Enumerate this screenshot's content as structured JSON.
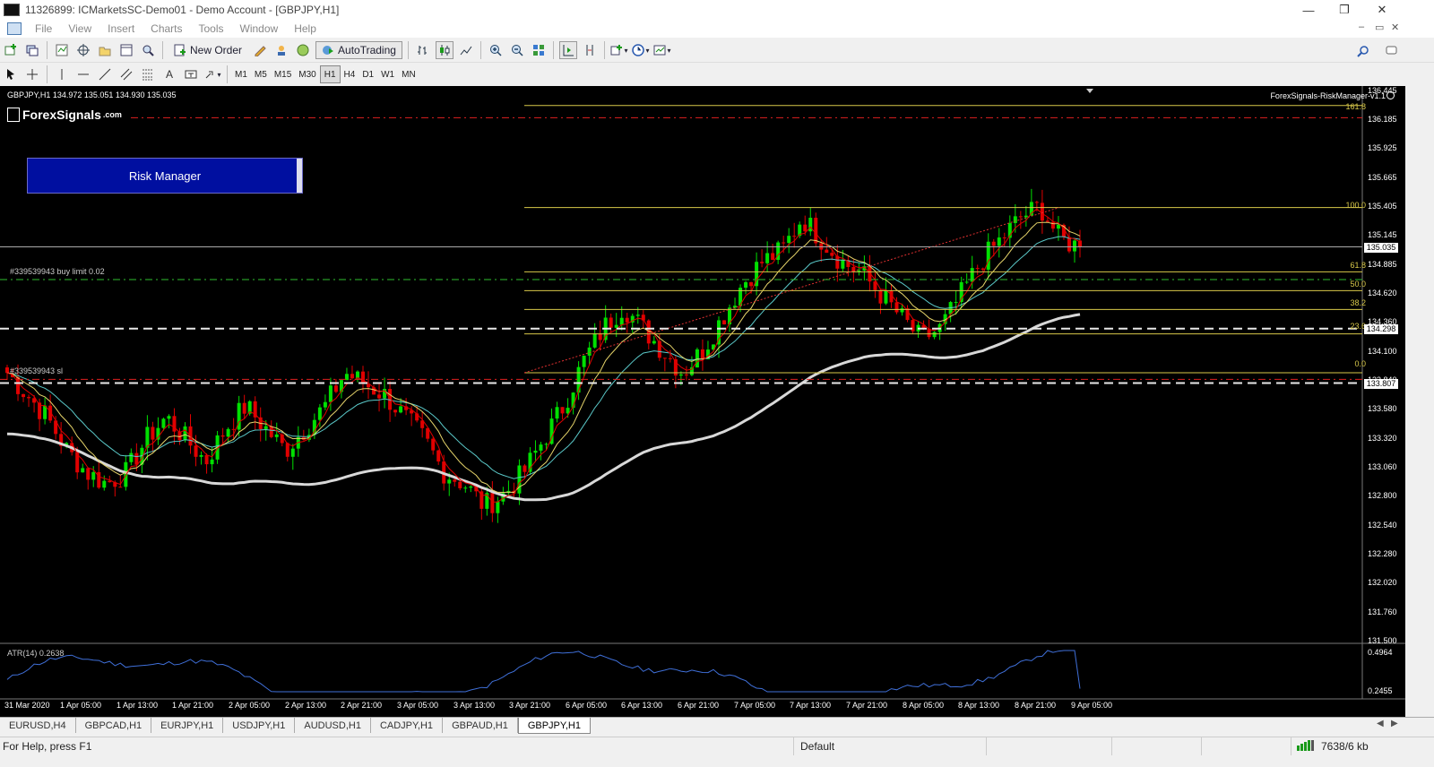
{
  "window": {
    "title": "11326899: ICMarketsSC-Demo01 - Demo Account - [GBPJPY,H1]",
    "controls": {
      "minimize": "—",
      "restore": "❐",
      "close": "✕"
    }
  },
  "menu": [
    "File",
    "View",
    "Insert",
    "Charts",
    "Tools",
    "Window",
    "Help"
  ],
  "toolbar": {
    "new_order": "New Order",
    "autotrading": "AutoTrading",
    "timeframes": [
      "M1",
      "M5",
      "M15",
      "M30",
      "H1",
      "H4",
      "D1",
      "W1",
      "MN"
    ],
    "active_timeframe": "H1",
    "text_tool": "A"
  },
  "chart": {
    "info": "GBPJPY,H1  134.972 135.051 134.930 135.035",
    "logo_text": "ForexSignals",
    "logo_suffix": ".com",
    "risk_button": "Risk Manager",
    "indicator_name": "ForexSignals-RiskManager-v1.1",
    "order_buy_limit": "#339539943 buy limit 0.02",
    "order_sl": "#339539943 sl",
    "atr_label": "ATR(14) 0.2638",
    "current_price": "135.035",
    "sl_price_box": "133.807",
    "buy_price_box": "134.298",
    "price_labels": [
      "136.445",
      "136.185",
      "135.925",
      "135.665",
      "135.405",
      "135.145",
      "134.885",
      "134.620",
      "134.360",
      "134.100",
      "133.840",
      "133.580",
      "133.320",
      "133.060",
      "132.800",
      "132.540",
      "132.280",
      "132.020",
      "131.760",
      "131.500"
    ],
    "atr_scale": [
      "0.4964",
      "0.2455"
    ],
    "fib_levels": [
      {
        "label": "161.8"
      },
      {
        "label": "100.0"
      },
      {
        "label": "61.8"
      },
      {
        "label": "50.0"
      },
      {
        "label": "38.2"
      },
      {
        "label": "23.6"
      },
      {
        "label": "0.0"
      }
    ],
    "time_labels": [
      "31 Mar 2020",
      "1 Apr 05:00",
      "1 Apr 13:00",
      "1 Apr 21:00",
      "2 Apr 05:00",
      "2 Apr 13:00",
      "2 Apr 21:00",
      "3 Apr 05:00",
      "3 Apr 13:00",
      "3 Apr 21:00",
      "6 Apr 05:00",
      "6 Apr 13:00",
      "6 Apr 21:00",
      "7 Apr 05:00",
      "7 Apr 13:00",
      "7 Apr 21:00",
      "8 Apr 05:00",
      "8 Apr 13:00",
      "8 Apr 21:00",
      "9 Apr 05:00"
    ],
    "colors": {
      "bull": "#00e000",
      "bear": "#e00000",
      "ema_fast": "#e00000",
      "ema_mid": "#e6d46a",
      "ema_slow": "#5ac8c8",
      "ma200": "#d8d8d8",
      "fib": "#d8c84a",
      "atr": "#3f6fd8"
    }
  },
  "chart_data": {
    "type": "candlestick",
    "symbol": "GBPJPY",
    "timeframe": "H1",
    "ylim": [
      131.5,
      136.445
    ],
    "key_levels": {
      "current_price": 135.035,
      "buy_limit": 134.74,
      "stop_loss": 133.84,
      "sl_line": 133.807,
      "entry_line": 134.298,
      "fib_0": 133.9,
      "fib_100": 135.39,
      "fib_161_8": 136.31,
      "fib_61_8": 134.81,
      "fib_50": 134.64,
      "fib_38_2": 134.47,
      "fib_23_6": 134.25
    },
    "close_path": [
      133.9,
      133.7,
      133.5,
      133.2,
      133.0,
      132.9,
      133.0,
      133.3,
      133.5,
      133.3,
      133.1,
      133.4,
      133.6,
      133.4,
      133.2,
      133.4,
      133.6,
      133.9,
      133.8,
      133.7,
      133.5,
      133.3,
      133.0,
      132.9,
      132.7,
      132.8,
      133.0,
      133.3,
      133.6,
      134.0,
      134.3,
      134.5,
      134.3,
      134.1,
      133.9,
      134.1,
      134.4,
      134.7,
      134.9,
      135.0,
      135.3,
      135.1,
      134.9,
      134.8,
      134.6,
      134.4,
      134.2,
      134.3,
      134.6,
      134.9,
      135.1,
      135.3,
      135.4,
      135.1,
      135.035
    ],
    "atr": {
      "label": "ATR(14)",
      "value": 0.2638,
      "range": [
        0.2455,
        0.4964
      ]
    }
  },
  "tabs": [
    "EURUSD,H4",
    "GBPCAD,H1",
    "EURJPY,H1",
    "USDJPY,H1",
    "AUDUSD,H1",
    "CADJPY,H1",
    "GBPAUD,H1",
    "GBPJPY,H1"
  ],
  "active_tab": "GBPJPY,H1",
  "status": {
    "help": "For Help, press F1",
    "profile": "Default",
    "traffic": "7638/6 kb"
  }
}
